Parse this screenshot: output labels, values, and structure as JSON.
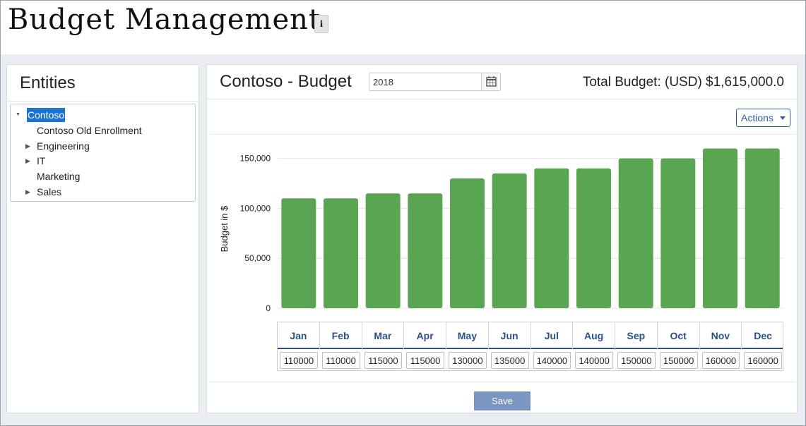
{
  "header": {
    "title": "Budget Management",
    "info_label": "i"
  },
  "entities": {
    "title": "Entities",
    "tree": [
      {
        "label": "Contoso",
        "expanded": true,
        "selected": true,
        "has_children": true,
        "depth": 0
      },
      {
        "label": "Contoso Old Enrollment",
        "has_children": false,
        "depth": 1
      },
      {
        "label": "Engineering",
        "has_children": true,
        "expanded": false,
        "depth": 1
      },
      {
        "label": "IT",
        "has_children": true,
        "expanded": false,
        "depth": 1
      },
      {
        "label": "Marketing",
        "has_children": false,
        "depth": 1
      },
      {
        "label": "Sales",
        "has_children": true,
        "expanded": false,
        "depth": 1
      }
    ]
  },
  "budget": {
    "title": "Contoso - Budget",
    "year": "2018",
    "total": "Total Budget: (USD) $1,615,000.0",
    "actions_label": "Actions",
    "save_label": "Save",
    "months": [
      "Jan",
      "Feb",
      "Mar",
      "Apr",
      "May",
      "Jun",
      "Jul",
      "Aug",
      "Sep",
      "Oct",
      "Nov",
      "Dec"
    ],
    "values": [
      "110000",
      "110000",
      "115000",
      "115000",
      "130000",
      "135000",
      "140000",
      "140000",
      "150000",
      "150000",
      "160000",
      "160000"
    ]
  },
  "colors": {
    "bar": "#5aa552",
    "accent": "#2c4f8a",
    "selected": "#1a73d1",
    "save": "#7b96c3"
  },
  "chart_data": {
    "type": "bar",
    "categories": [
      "Jan",
      "Feb",
      "Mar",
      "Apr",
      "May",
      "Jun",
      "Jul",
      "Aug",
      "Sep",
      "Oct",
      "Nov",
      "Dec"
    ],
    "values": [
      110000,
      110000,
      115000,
      115000,
      130000,
      135000,
      140000,
      140000,
      150000,
      150000,
      160000,
      160000
    ],
    "ylabel": "Budget in $",
    "ylim": [
      0,
      160000
    ],
    "yticks": [
      0,
      50000,
      100000,
      150000
    ],
    "ytick_labels": [
      "0",
      "50,000",
      "100,000",
      "150,000"
    ],
    "grid": true
  }
}
